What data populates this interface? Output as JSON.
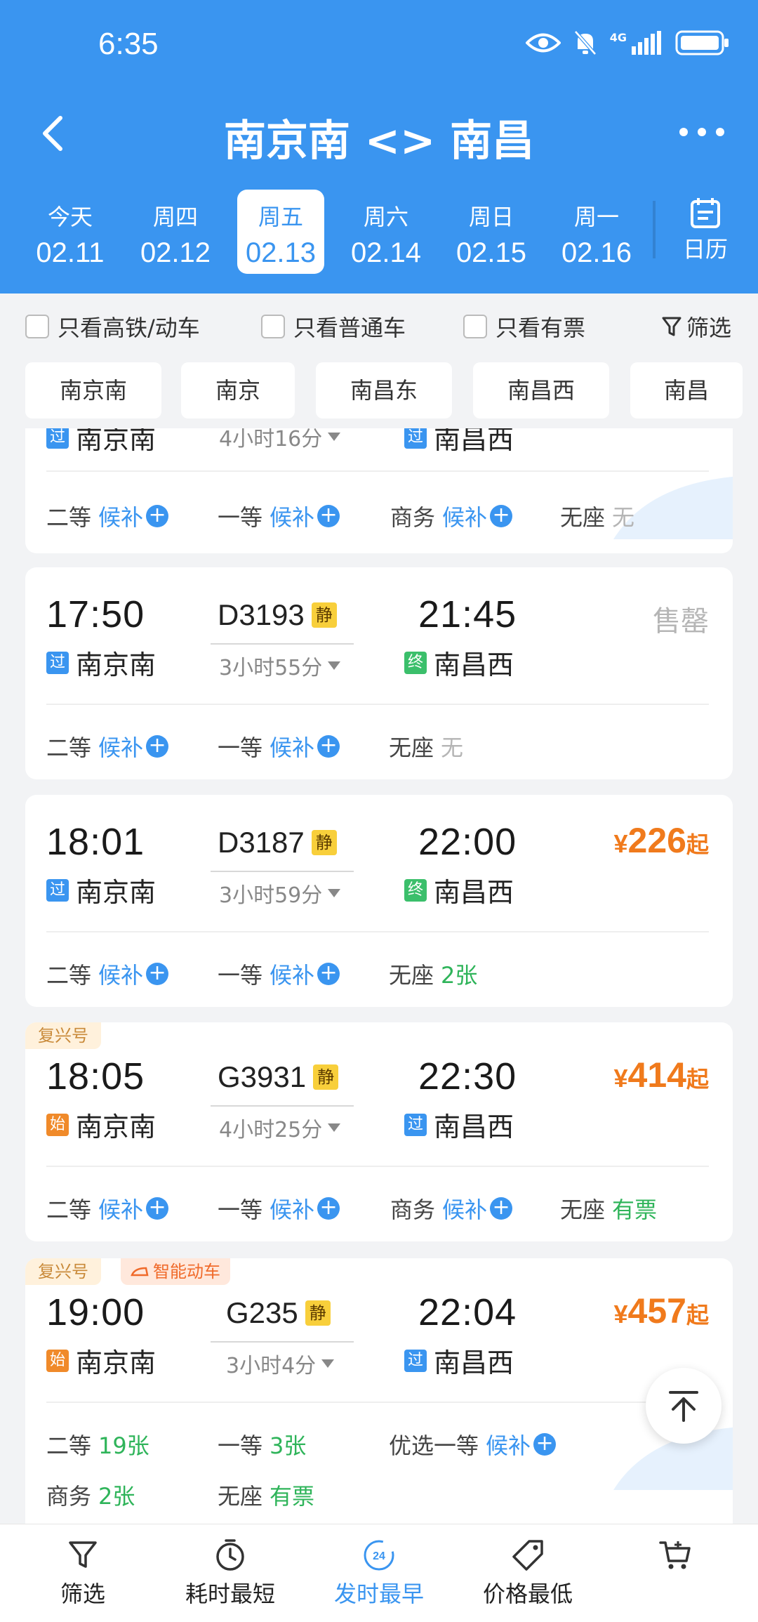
{
  "status_bar": {
    "time": "6:35",
    "network": "4G"
  },
  "header": {
    "title": "南京南 <> 南昌",
    "dates": [
      {
        "weekday": "今天",
        "date": "02.11",
        "selected": false
      },
      {
        "weekday": "周四",
        "date": "02.12",
        "selected": false
      },
      {
        "weekday": "周五",
        "date": "02.13",
        "selected": true
      },
      {
        "weekday": "周六",
        "date": "02.14",
        "selected": false
      },
      {
        "weekday": "周日",
        "date": "02.15",
        "selected": false
      },
      {
        "weekday": "周一",
        "date": "02.16",
        "selected": false
      }
    ],
    "calendar_label": "日历"
  },
  "filters": {
    "only_high_speed": "只看高铁/动车",
    "only_normal": "只看普通车",
    "only_available": "只看有票",
    "filter": "筛选"
  },
  "stations": [
    "南京南",
    "南京",
    "南昌东",
    "南昌西",
    "南昌"
  ],
  "trains": [
    {
      "partial": true,
      "dep_tag": "过",
      "dep_station": "南京南",
      "duration": "4小时16分",
      "arr_tag": "过",
      "arr_station": "南昌西",
      "seats": [
        {
          "name": "二等",
          "status": "候补",
          "type": "wait"
        },
        {
          "name": "一等",
          "status": "候补",
          "type": "wait"
        },
        {
          "name": "商务",
          "status": "候补",
          "type": "wait"
        },
        {
          "name": "无座",
          "status": "无",
          "type": "none"
        }
      ]
    },
    {
      "dep_time": "17:50",
      "train_no": "D3193",
      "quiet": "静",
      "arr_time": "21:45",
      "dep_tag": "过",
      "dep_station": "南京南",
      "duration": "3小时55分",
      "arr_tag": "终",
      "arr_station": "南昌西",
      "sold_out": "售罄",
      "seats": [
        {
          "name": "二等",
          "status": "候补",
          "type": "wait"
        },
        {
          "name": "一等",
          "status": "候补",
          "type": "wait"
        },
        {
          "name": "无座",
          "status": "无",
          "type": "none"
        }
      ]
    },
    {
      "dep_time": "18:01",
      "train_no": "D3187",
      "quiet": "静",
      "arr_time": "22:00",
      "dep_tag": "过",
      "dep_station": "南京南",
      "duration": "3小时59分",
      "arr_tag": "终",
      "arr_station": "南昌西",
      "price": {
        "currency": "¥",
        "amount": "226",
        "suffix": "起"
      },
      "seats": [
        {
          "name": "二等",
          "status": "候补",
          "type": "wait"
        },
        {
          "name": "一等",
          "status": "候补",
          "type": "wait"
        },
        {
          "name": "无座",
          "status": "2张",
          "type": "avail"
        }
      ]
    },
    {
      "badge": "复兴号",
      "dep_time": "18:05",
      "train_no": "G3931",
      "quiet": "静",
      "arr_time": "22:30",
      "dep_tag": "始",
      "dep_station": "南京南",
      "duration": "4小时25分",
      "arr_tag": "过",
      "arr_station": "南昌西",
      "price": {
        "currency": "¥",
        "amount": "414",
        "suffix": "起"
      },
      "seats": [
        {
          "name": "二等",
          "status": "候补",
          "type": "wait"
        },
        {
          "name": "一等",
          "status": "候补",
          "type": "wait"
        },
        {
          "name": "商务",
          "status": "候补",
          "type": "wait"
        },
        {
          "name": "无座",
          "status": "有票",
          "type": "avail"
        }
      ]
    },
    {
      "badge": "复兴号",
      "badge2": "智能动车",
      "dep_time": "19:00",
      "train_no": "G235",
      "quiet": "静",
      "arr_time": "22:04",
      "dep_tag": "始",
      "dep_station": "南京南",
      "duration": "3小时4分",
      "arr_tag": "过",
      "arr_station": "南昌西",
      "price": {
        "currency": "¥",
        "amount": "457",
        "suffix": "起"
      },
      "seats": [
        {
          "name": "二等",
          "status": "19张",
          "type": "avail"
        },
        {
          "name": "一等",
          "status": "3张",
          "type": "avail"
        },
        {
          "name": "优选一等",
          "status": "候补",
          "type": "wait"
        },
        {
          "name": "商务",
          "status": "2张",
          "type": "avail"
        },
        {
          "name": "无座",
          "status": "有票",
          "type": "avail"
        }
      ]
    }
  ],
  "bottom_bar": [
    {
      "label": "筛选",
      "icon": "filter-icon",
      "active": false
    },
    {
      "label": "耗时最短",
      "icon": "clock-icon",
      "active": false
    },
    {
      "label": "发时最早",
      "icon": "earliest-icon",
      "active": true
    },
    {
      "label": "价格最低",
      "icon": "price-tag-icon",
      "active": false
    },
    {
      "label": "",
      "icon": "cart-icon",
      "active": false
    }
  ],
  "colors": {
    "primary": "#3a95f0",
    "price": "#f07a1c",
    "available": "#2fb45a",
    "quiet_badge": "#f8cf3b"
  }
}
